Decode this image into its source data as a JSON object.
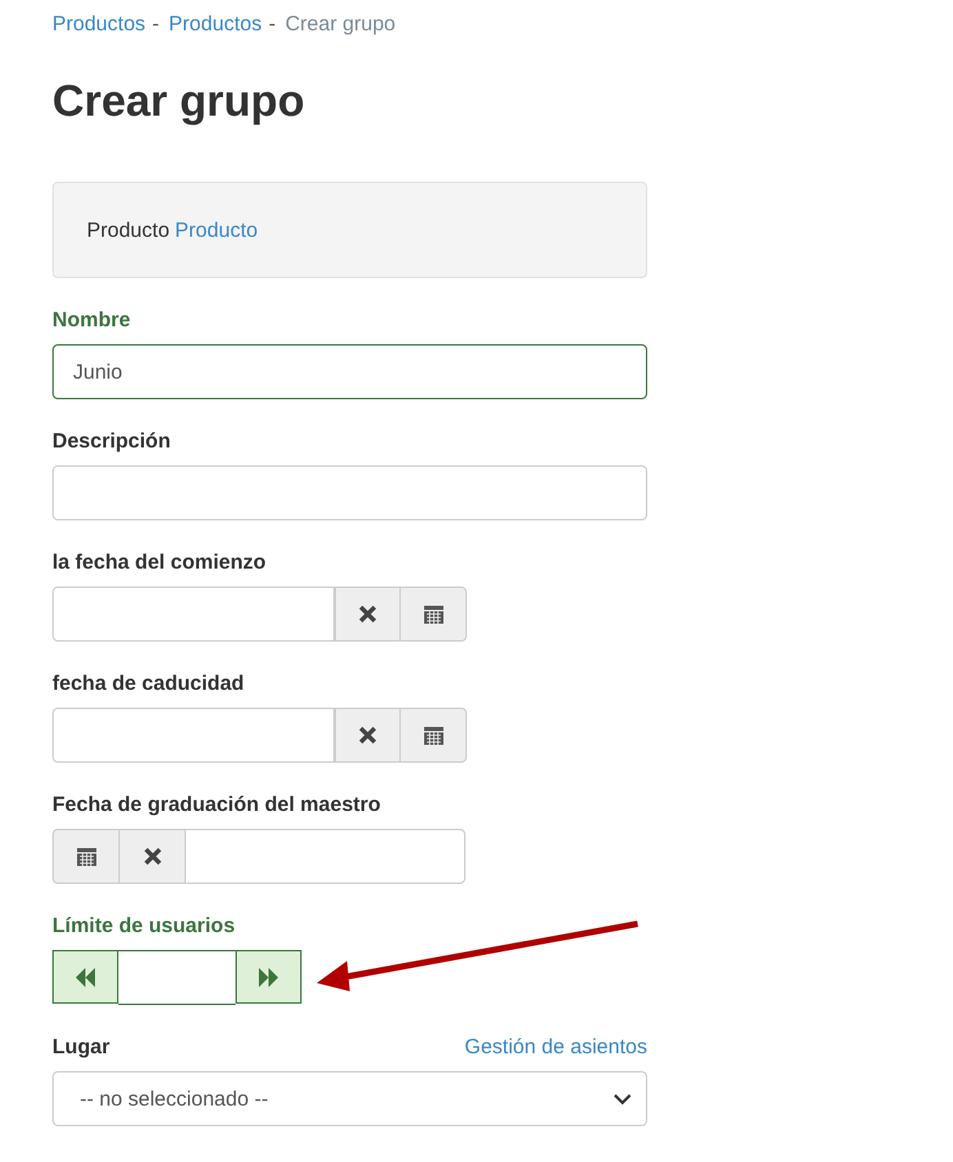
{
  "breadcrumb": [
    {
      "label": "Productos",
      "link": true,
      "separator": "-"
    },
    {
      "label": "Productos",
      "link": true,
      "separator": "-"
    },
    {
      "label": "Crear grupo",
      "link": false
    }
  ],
  "title": "Crear grupo",
  "info_box": {
    "label": "Producto",
    "link": "Producto"
  },
  "fields": [
    {
      "kind": "text",
      "label": "Nombre",
      "value": "Junio",
      "valid": true
    },
    {
      "kind": "text",
      "label": "Descripción",
      "valid": false
    },
    {
      "kind": "date",
      "label": "la fecha del comienzo",
      "valid": false
    },
    {
      "kind": "date",
      "label": "fecha de caducidad",
      "valid": false
    },
    {
      "kind": "date_reversed",
      "label": "Fecha de graduación del maestro",
      "valid": false
    },
    {
      "kind": "spinner",
      "label": "Límite de usuarios",
      "valid": true,
      "annotated": true
    },
    {
      "kind": "select",
      "label": "Lugar",
      "link": "Gestión de asientos",
      "value": "-- no seleccionado --",
      "valid": false
    }
  ]
}
